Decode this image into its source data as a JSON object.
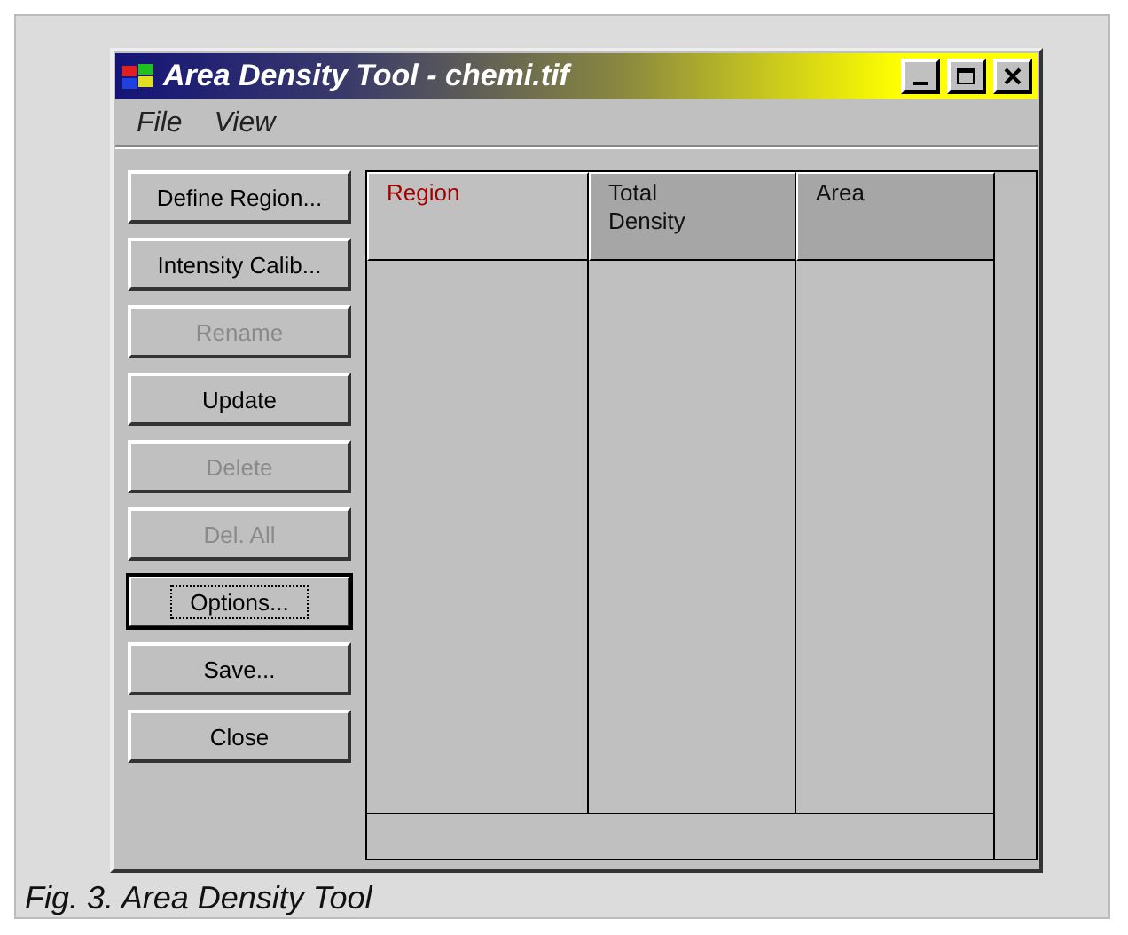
{
  "window": {
    "title": "Area Density Tool - chemi.tif"
  },
  "menu": [
    {
      "label": "File"
    },
    {
      "label": "View"
    }
  ],
  "buttons": [
    {
      "label": "Define Region...",
      "disabled": false,
      "focused": false
    },
    {
      "label": "Intensity Calib...",
      "disabled": false,
      "focused": false
    },
    {
      "label": "Rename",
      "disabled": true,
      "focused": false
    },
    {
      "label": "Update",
      "disabled": false,
      "focused": false
    },
    {
      "label": "Delete",
      "disabled": true,
      "focused": false
    },
    {
      "label": "Del. All",
      "disabled": true,
      "focused": false
    },
    {
      "label": "Options...",
      "disabled": false,
      "focused": true
    },
    {
      "label": "Save...",
      "disabled": false,
      "focused": false
    },
    {
      "label": "Close",
      "disabled": false,
      "focused": false
    }
  ],
  "table": {
    "columns": [
      {
        "label": "Region",
        "selected": true
      },
      {
        "label": "Total Density",
        "selected": false
      },
      {
        "label": "Area",
        "selected": false
      }
    ]
  },
  "caption": "Fig. 3. Area Density Tool"
}
